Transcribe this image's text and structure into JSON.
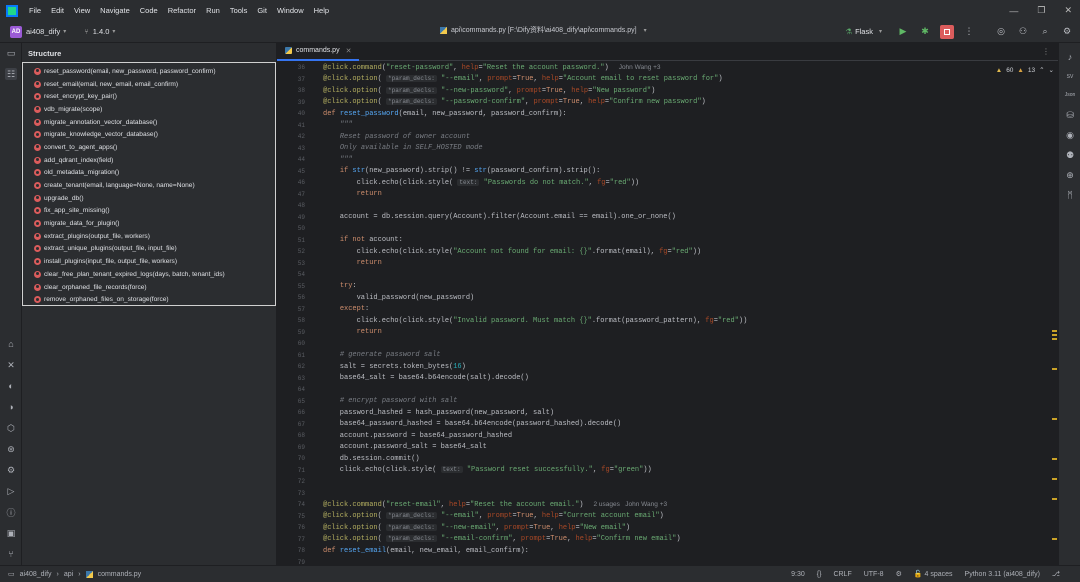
{
  "menu": [
    "File",
    "Edit",
    "View",
    "Navigate",
    "Code",
    "Refactor",
    "Run",
    "Tools",
    "Git",
    "Window",
    "Help"
  ],
  "toolbar": {
    "project_badge": "AD",
    "project_name": "ai408_dify",
    "branch": "1.4.0",
    "file_path": "api\\commands.py [F:\\Dify资料\\ai408_dify\\api\\commands.py]",
    "run_config": "Flask"
  },
  "structure": {
    "title": "Structure",
    "items": [
      "reset_password(email, new_password, password_confirm)",
      "reset_email(email, new_email, email_confirm)",
      "reset_encrypt_key_pair()",
      "vdb_migrate(scope)",
      "migrate_annotation_vector_database()",
      "migrate_knowledge_vector_database()",
      "convert_to_agent_apps()",
      "add_qdrant_index(field)",
      "old_metadata_migration()",
      "create_tenant(email, language=None, name=None)",
      "upgrade_db()",
      "fix_app_site_missing()",
      "migrate_data_for_plugin()",
      "extract_plugins(output_file, workers)",
      "extract_unique_plugins(output_file, input_file)",
      "install_plugins(input_file, output_file, workers)",
      "clear_free_plan_tenant_expired_logs(days, batch, tenant_ids)",
      "clear_orphaned_file_records(force)",
      "remove_orphaned_files_on_storage(force)"
    ]
  },
  "editor": {
    "tab": "commands.py",
    "warnings": "60",
    "weak_warnings": "13",
    "line_numbers": [
      "36",
      "37",
      "38",
      "39",
      "40",
      "41",
      "42",
      "43",
      "44",
      "45",
      "46",
      "47",
      "48",
      "49",
      "50",
      "51",
      "52",
      "53",
      "54",
      "55",
      "56",
      "57",
      "58",
      "59",
      "60",
      "61",
      "62",
      "63",
      "64",
      "65",
      "66",
      "67",
      "68",
      "69",
      "70",
      "71",
      "72",
      "73",
      "74",
      "75",
      "76",
      "77",
      "78",
      "79"
    ],
    "author_1": "John Wang +3",
    "author_2": "2 usages   John Wang +3"
  },
  "status": {
    "crumbs": [
      "ai408_dify",
      "api",
      "commands.py"
    ],
    "position": "9:30",
    "line_sep": "CRLF",
    "encoding": "UTF-8",
    "indent": "4 spaces",
    "interpreter": "Python 3.11 (ai408_dify)"
  }
}
